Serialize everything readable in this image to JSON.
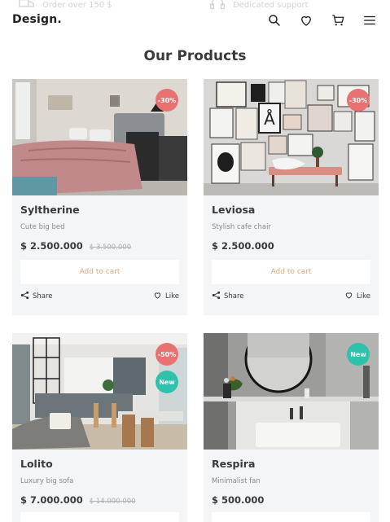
{
  "topbar": {
    "features": [
      {
        "text": "Order over 150 $",
        "icon": "shipping-icon"
      },
      {
        "text": "Dedicated support",
        "icon": "support-icon"
      }
    ]
  },
  "header": {
    "logo": "Design.",
    "icons": [
      "search-icon",
      "heart-icon",
      "cart-icon",
      "menu-icon"
    ]
  },
  "section": {
    "title": "Our Products"
  },
  "products": [
    {
      "name": "Syltherine",
      "description": "Cute big bed",
      "price": "$ 2.500.000",
      "old_price": "$ 3.500.000",
      "badges": [
        "-30%"
      ],
      "add_to_cart": "Add to cart",
      "share": "Share",
      "like": "Like"
    },
    {
      "name": "Leviosa",
      "description": "Stylish cafe chair",
      "price": "$ 2.500.000",
      "old_price": "",
      "badges": [
        "-30%"
      ],
      "add_to_cart": "Add to cart",
      "share": "Share",
      "like": "Like"
    },
    {
      "name": "Lolito",
      "description": "Luxury big sofa",
      "price": "$ 7.000.000",
      "old_price": "$ 14.000.000",
      "badges": [
        "-50%",
        "New"
      ]
    },
    {
      "name": "Respira",
      "description": "Minimalist fan",
      "price": "$ 500.000",
      "old_price": "",
      "badges": [
        "New"
      ]
    }
  ],
  "colors": {
    "accent": "#e2a57a",
    "sale_badge": "#e97171",
    "new_badge": "#2ec1ac",
    "card_bg": "#f4f5f7"
  }
}
